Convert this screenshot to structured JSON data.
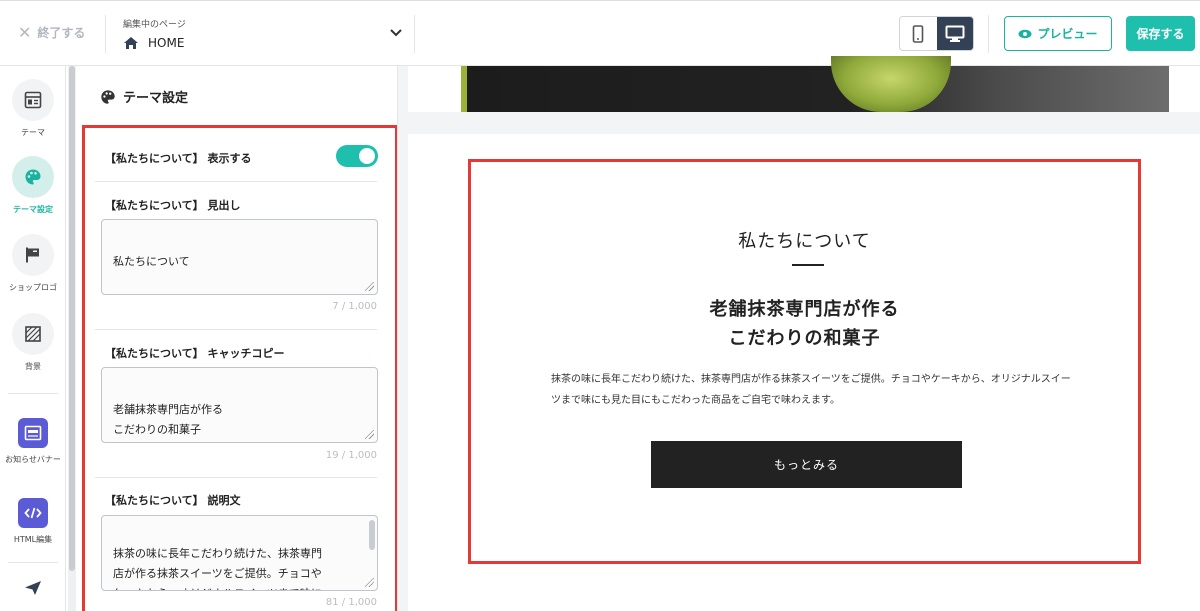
{
  "header": {
    "exit_label": "終了する",
    "page_caption": "編集中のページ",
    "page_name": "HOME",
    "preview_label": "プレビュー",
    "save_label": "保存する",
    "accent_color": "#1fbfae"
  },
  "rail": {
    "items": [
      {
        "label": "テーマ",
        "icon": "layout-icon"
      },
      {
        "label": "テーマ設定",
        "icon": "palette-icon",
        "active": true
      },
      {
        "label": "ショップロゴ",
        "icon": "flag-icon"
      },
      {
        "label": "背景",
        "icon": "pattern-icon"
      },
      {
        "label": "お知らせバナー",
        "icon": "banner-icon"
      },
      {
        "label": "HTML編集",
        "icon": "code-icon"
      },
      {
        "label": "",
        "icon": "send-icon"
      }
    ]
  },
  "panel": {
    "title": "テーマ設定",
    "display_label": "【私たちについて】 表示する",
    "display_on": true,
    "heading_label": "【私たちについて】 見出し",
    "heading_value": "私たちについて",
    "heading_count": "7 / 1,000",
    "catch_label": "【私たちについて】 キャッチコピー",
    "catch_value": "老舗抹茶専門店が作る\nこだわりの和菓子",
    "catch_count": "19 / 1,000",
    "desc_label": "【私たちについて】 説明文",
    "desc_value": "抹茶の味に長年こだわり続けた、抹茶専門\n店が作る抹茶スイーツをご提供。チョコや\nケーキから、オリジナルスイーツまで味に\nも見た目にもこだわった商品をご自宅で",
    "desc_count": "81 / 1,000"
  },
  "preview": {
    "heading": "私たちについて",
    "catch": "老舗抹茶専門店が作る\nこだわりの和菓子",
    "desc": "抹茶の味に長年こだわり続けた、抹茶専門店が作る抹茶スイーツをご提供。チョコやケーキから、オリジナルスイーツまで味にも見た目にもこだわった商品をご自宅で味わえます。",
    "more_label": "もっとみる"
  }
}
